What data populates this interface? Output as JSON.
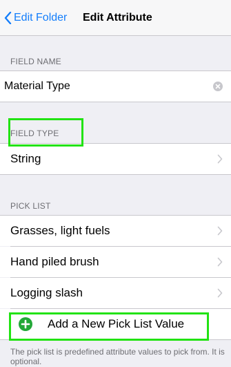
{
  "nav": {
    "back_label": "Edit Folder",
    "title": "Edit Attribute"
  },
  "field_name": {
    "header": "FIELD NAME",
    "value": "Material Type"
  },
  "field_type": {
    "header": "FIELD TYPE",
    "value": "String"
  },
  "pick_list": {
    "header": "PICK LIST",
    "items": [
      {
        "label": "Grasses, light fuels"
      },
      {
        "label": "Hand piled brush"
      },
      {
        "label": "Logging slash"
      }
    ],
    "add_label": "Add a New Pick List Value",
    "footer": "The pick list is predefined attribute values to pick from. It is optional."
  },
  "colors": {
    "accent": "#147efb",
    "highlight": "#22e313",
    "add_icon": "#23a838",
    "background": "#efeff4"
  }
}
